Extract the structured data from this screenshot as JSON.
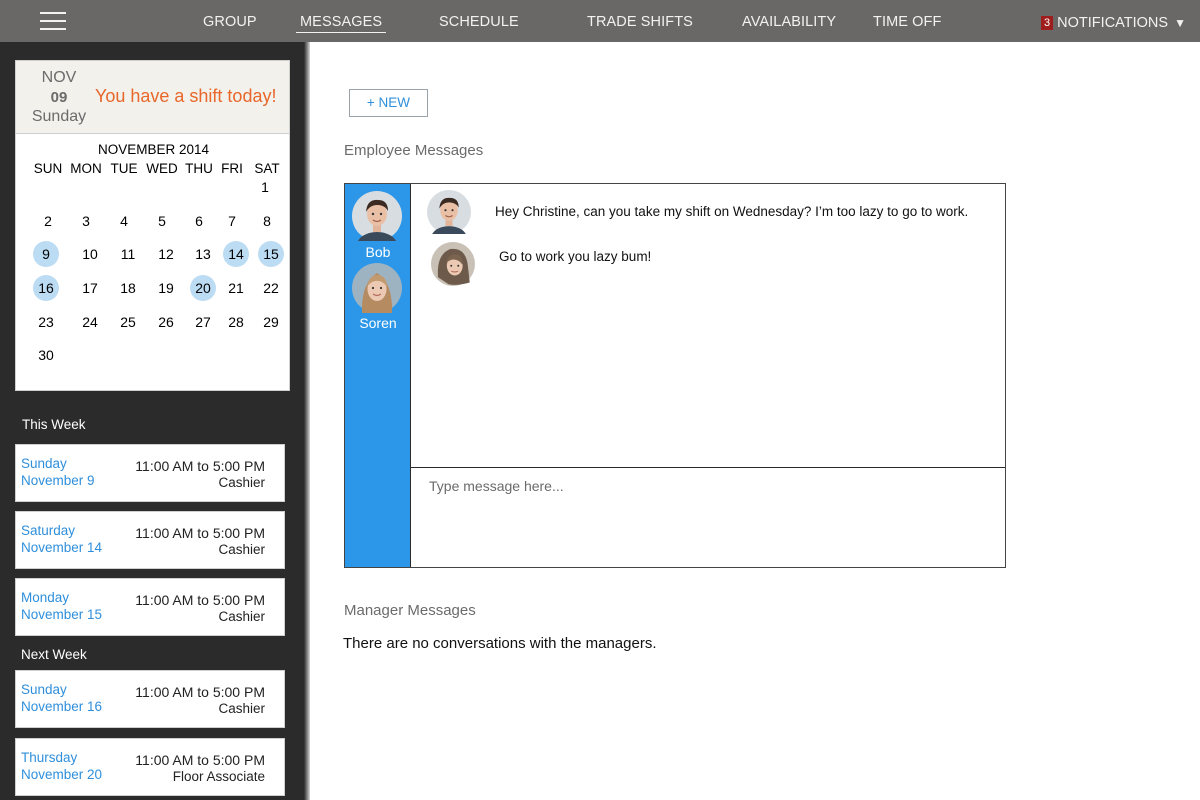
{
  "nav": {
    "items": [
      {
        "label": "GROUP",
        "active": false
      },
      {
        "label": "MESSAGES",
        "active": true
      },
      {
        "label": "SCHEDULE",
        "active": false
      },
      {
        "label": "TRADE SHIFTS",
        "active": false
      },
      {
        "label": "AVAILABILITY",
        "active": false
      },
      {
        "label": "TIME OFF",
        "active": false
      }
    ],
    "notifications": {
      "count": "3",
      "label": "NOTIFICATIONS",
      "caret": "▼"
    }
  },
  "today": {
    "month": "NOV",
    "day": "09",
    "weekday": "Sunday",
    "message": "You have a shift today!"
  },
  "calendar": {
    "title": "NOVEMBER 2014",
    "weekdays": [
      "SUN",
      "MON",
      "TUE",
      "WED",
      "THU",
      "FRI",
      "SAT"
    ],
    "weeks": [
      [
        "",
        "",
        "",
        "",
        "",
        "",
        "1"
      ],
      [
        "2",
        "3",
        "4",
        "5",
        "6",
        "7",
        "8"
      ],
      [
        "9",
        "10",
        "11",
        "12",
        "13",
        "14",
        "15"
      ],
      [
        "16",
        "17",
        "18",
        "19",
        "20",
        "21",
        "22"
      ],
      [
        "23",
        "24",
        "25",
        "26",
        "27",
        "28",
        "29"
      ],
      [
        "30",
        "",
        "",
        "",
        "",
        "",
        ""
      ]
    ],
    "highlighted": [
      "9",
      "14",
      "15",
      "16",
      "20"
    ]
  },
  "this_week": {
    "label": "This Week",
    "shifts": [
      {
        "weekday": "Sunday",
        "date": "November 9",
        "time": "11:00 AM to 5:00 PM",
        "role": "Cashier"
      },
      {
        "weekday": "Saturday",
        "date": "November 14",
        "time": "11:00 AM to 5:00 PM",
        "role": "Cashier"
      },
      {
        "weekday": "Monday",
        "date": "November 15",
        "time": "11:00 AM to 5:00 PM",
        "role": "Cashier"
      }
    ]
  },
  "next_week": {
    "label": "Next Week",
    "shifts": [
      {
        "weekday": "Sunday",
        "date": "November 16",
        "time": "11:00 AM to 5:00 PM",
        "role": "Cashier"
      },
      {
        "weekday": "Thursday",
        "date": "November 20",
        "time": "11:00 AM to 5:00 PM",
        "role": "Floor Associate"
      }
    ]
  },
  "main": {
    "new_button": "+ NEW",
    "employee_title": "Employee Messages",
    "contacts": [
      {
        "name": "Bob",
        "avatar": "male-avatar"
      },
      {
        "name": "Soren",
        "avatar": "female-avatar"
      }
    ],
    "messages": [
      {
        "avatar": "male-avatar",
        "text": "Hey Christine, can you take my shift on Wednesday? I’m too lazy to go to work."
      },
      {
        "avatar": "female-avatar",
        "text": "Go to work you lazy bum!"
      }
    ],
    "composer_placeholder": "Type message here...",
    "manager_title": "Manager Messages",
    "manager_empty": "There are no conversations with the managers."
  },
  "colors": {
    "topbar": "#6a6866",
    "sidebar": "#2c2b2b",
    "accent_blue": "#2c97e8",
    "link_blue": "#2f8fdb",
    "highlight": "#bcdcf3",
    "alert_orange": "#e8672a",
    "badge_red": "#9f1c1c"
  }
}
